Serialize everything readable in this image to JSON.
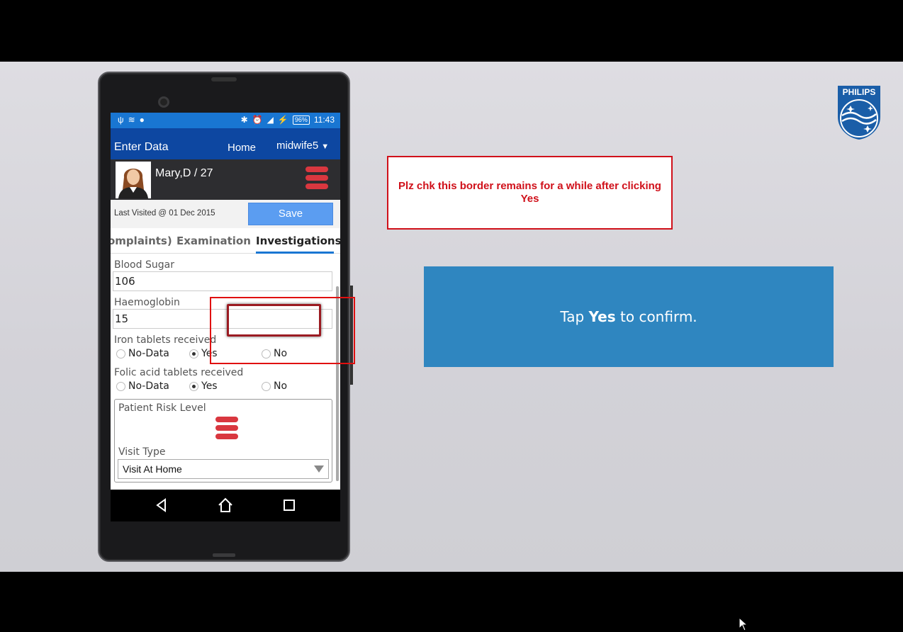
{
  "status_bar": {
    "left_icons": [
      "usb-icon",
      "wifi-icon",
      "android-icon"
    ],
    "battery": "96%",
    "time": "11:43"
  },
  "app_bar": {
    "title": "Enter Data",
    "home": "Home",
    "user": "midwife5",
    "caret": "▼"
  },
  "patient": {
    "name": "Mary,D / 27"
  },
  "visit": {
    "last_visited": "Last Visited @ 01 Dec 2015",
    "save_label": "Save"
  },
  "tabs": {
    "complaints": "omplaints)",
    "examination": "Examination",
    "investigations": "Investigations"
  },
  "form": {
    "blood_sugar_label": "Blood Sugar",
    "blood_sugar_value": "106",
    "haemoglobin_label": "Haemoglobin",
    "haemoglobin_value": "15",
    "iron_label": "Iron tablets received",
    "folic_label": "Folic acid tablets received",
    "options": {
      "no_data": "No-Data",
      "yes": "Yes",
      "no": "No"
    },
    "iron_selected": "Yes",
    "folic_selected": "Yes",
    "risk_label": "Patient Risk Level",
    "visit_type_label": "Visit Type",
    "visit_type_value": "Visit At Home"
  },
  "annotation": {
    "text": "Plz chk this border remains for a while after clicking Yes"
  },
  "instruction": {
    "prefix": "Tap ",
    "bold": "Yes",
    "suffix": " to confirm."
  },
  "logo": {
    "text": "PHILIPS"
  },
  "colors": {
    "status_bar": "#1976d2",
    "app_bar": "#0d47a1",
    "risk_red": "#d9373f",
    "instruction_blue": "#2f86c0",
    "annotation_red": "#d0101a"
  }
}
